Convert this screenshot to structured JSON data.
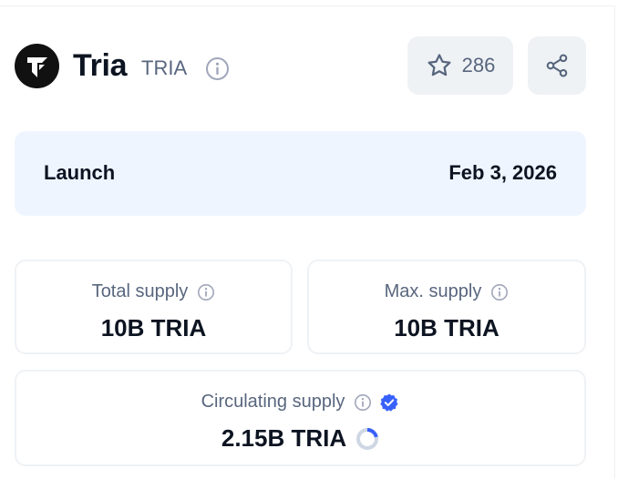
{
  "coin": {
    "name": "Tria",
    "symbol": "TRIA",
    "watchlist_count": "286"
  },
  "launch": {
    "label": "Launch",
    "date": "Feb 3, 2026"
  },
  "stats": {
    "total_supply": {
      "label": "Total supply",
      "value": "10B TRIA"
    },
    "max_supply": {
      "label": "Max. supply",
      "value": "10B TRIA"
    },
    "circulating_supply": {
      "label": "Circulating supply",
      "value": "2.15B TRIA",
      "progress_fraction": 0.215,
      "verified": true
    }
  },
  "colors": {
    "text_primary": "#0d1421",
    "text_secondary": "#58667e",
    "button_bg": "#eff2f5",
    "launch_bg": "#eff5ff",
    "verified_blue": "#3861fb",
    "progress_track": "#cfd6e4"
  },
  "icons": {
    "logo": "tria-logo-icon",
    "info": "info-icon",
    "watchlist": "star-icon",
    "share": "share-icon",
    "verified": "verified-badge-icon",
    "progress": "progress-ring-icon"
  }
}
